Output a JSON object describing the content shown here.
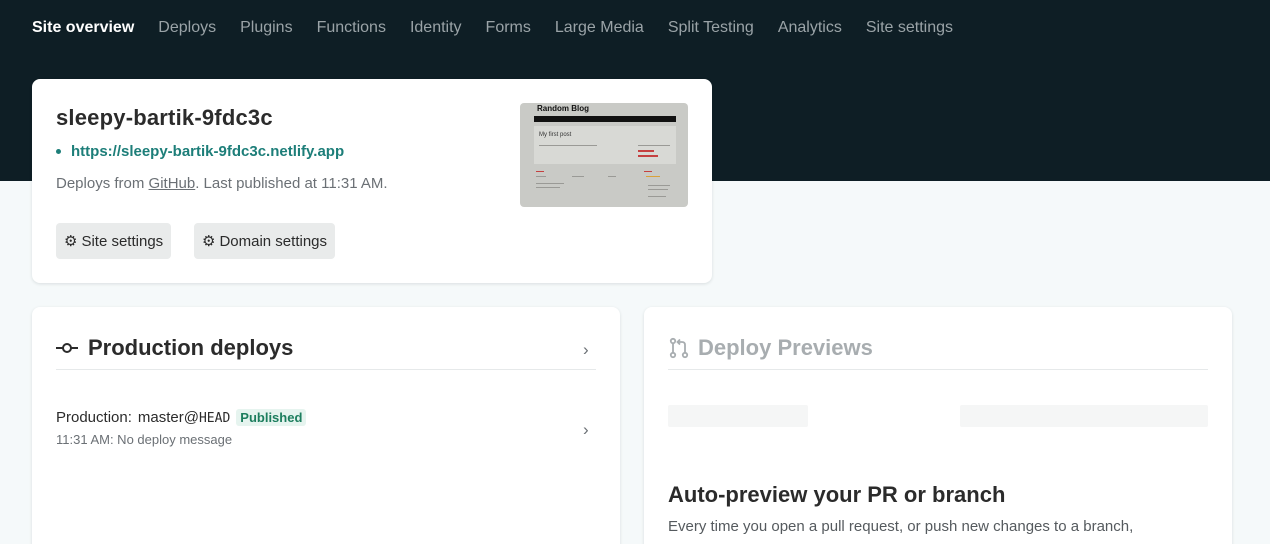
{
  "nav": {
    "items": [
      {
        "label": "Site overview",
        "active": true
      },
      {
        "label": "Deploys"
      },
      {
        "label": "Plugins"
      },
      {
        "label": "Functions"
      },
      {
        "label": "Identity"
      },
      {
        "label": "Forms"
      },
      {
        "label": "Large Media"
      },
      {
        "label": "Split Testing"
      },
      {
        "label": "Analytics"
      },
      {
        "label": "Site settings"
      }
    ]
  },
  "site": {
    "name": "sleepy-bartik-9fdc3c",
    "url": "https://sleepy-bartik-9fdc3c.netlify.app",
    "deploys_from_prefix": "Deploys from ",
    "deploys_from_source": "GitHub",
    "published_text": ". Last published at 11:31 AM.",
    "buttons": {
      "site_settings": "Site settings",
      "domain_settings": "Domain settings"
    },
    "thumbnail": {
      "title": "Random Blog",
      "post": "My first post"
    }
  },
  "production": {
    "title": "Production deploys",
    "row": {
      "label": "Production:",
      "branch": "master@",
      "ref": "HEAD",
      "status": "Published",
      "time_message": "11:31 AM: No deploy message"
    }
  },
  "previews": {
    "title": "Deploy Previews",
    "auto_title": "Auto-preview your PR or branch",
    "auto_text": "Every time you open a pull request, or push new changes to a branch,"
  },
  "colors": {
    "header_bg": "#0e1e25",
    "page_bg": "#f5f9fa",
    "accent_teal": "#1d7e79",
    "published_badge_bg": "#e6f4ef"
  },
  "icons": [
    "gear-icon",
    "commit-icon",
    "chevron-right-icon",
    "pull-request-icon"
  ]
}
